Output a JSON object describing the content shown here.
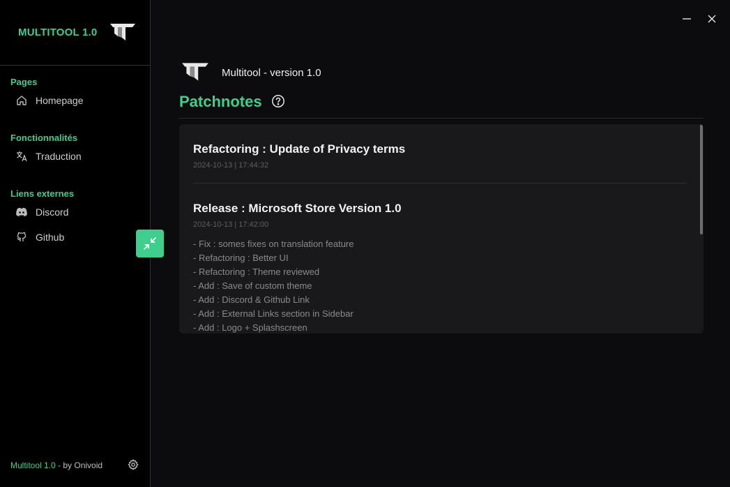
{
  "sidebar": {
    "brand_title": "MULTITOOL 1.0",
    "sections": [
      {
        "title": "Pages",
        "items": [
          {
            "label": "Homepage",
            "icon": "home-icon"
          }
        ]
      },
      {
        "title": "Fonctionnalités",
        "items": [
          {
            "label": "Traduction",
            "icon": "translate-icon"
          }
        ]
      },
      {
        "title": "Liens externes",
        "items": [
          {
            "label": "Discord",
            "icon": "discord-icon"
          },
          {
            "label": "Github",
            "icon": "github-icon"
          }
        ]
      }
    ],
    "footer_brand": "Multitool 1.0",
    "footer_by": " - by Onivoid"
  },
  "header": {
    "app_text": "Multitool - version 1.0"
  },
  "main": {
    "title": "Patchnotes",
    "notes": [
      {
        "title": "Refactoring : Update of Privacy terms",
        "date": "2024-10-13 | 17:44:32",
        "lines": []
      },
      {
        "title": "Release : Microsoft Store Version 1.0",
        "date": "2024-10-13 | 17:42:00",
        "lines": [
          "- Fix : somes fixes on translation feature",
          "- Refactoring : Better UI",
          "- Refactoring : Theme reviewed",
          "- Add : Save of custom theme",
          "- Add : Discord & Github Link",
          "- Add : External Links section in Sidebar",
          "- Add : Logo + Splashscreen"
        ]
      }
    ]
  },
  "colors": {
    "accent": "#3ecf8e",
    "background": "#0c0c0e",
    "sidebar": "#000000",
    "panel": "#19191c"
  }
}
